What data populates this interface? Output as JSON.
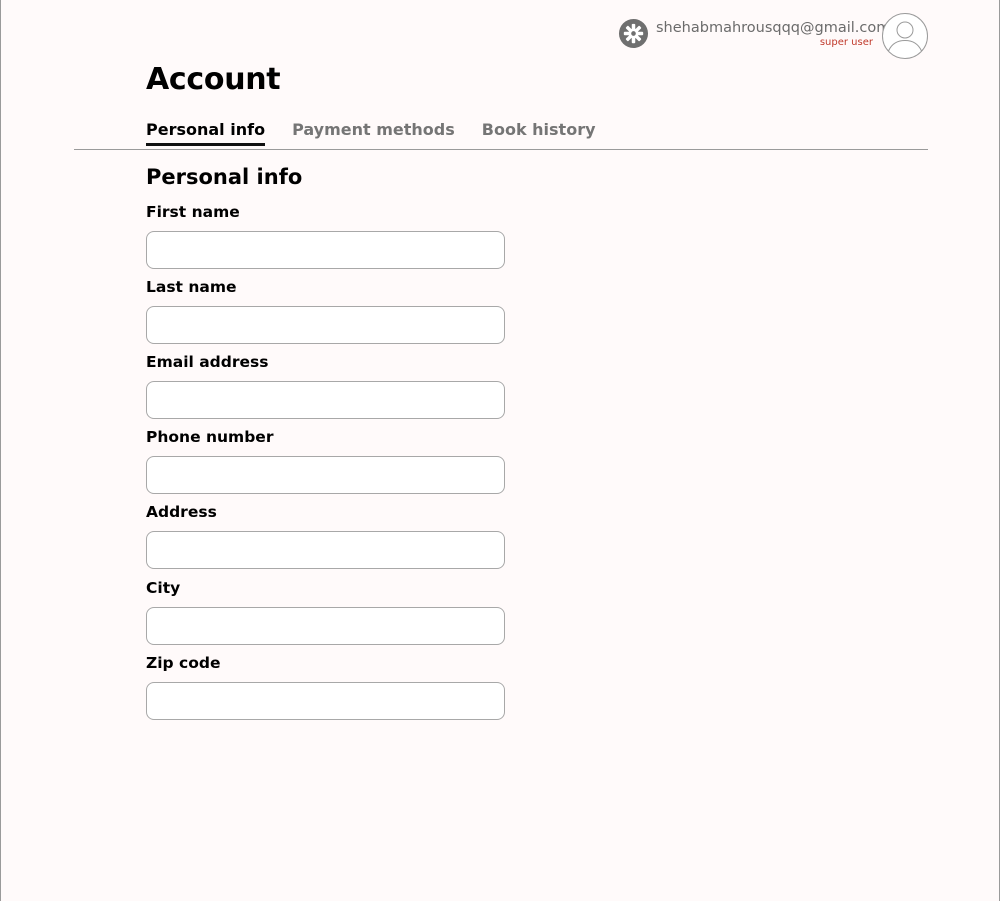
{
  "header": {
    "settings_icon": "gear-icon",
    "user_email": "shehabmahrousqqq@gmail.com",
    "user_role": "super user",
    "avatar_icon": "user-avatar-icon",
    "role_color": "#c0392b"
  },
  "page": {
    "title": "Account"
  },
  "tabs": [
    {
      "label": "Personal info",
      "active": true
    },
    {
      "label": "Payment methods",
      "active": false
    },
    {
      "label": "Book history",
      "active": false
    }
  ],
  "section": {
    "title": "Personal info"
  },
  "form": {
    "first_name": {
      "label": "First name",
      "value": "",
      "placeholder": ""
    },
    "last_name": {
      "label": "Last name",
      "value": "",
      "placeholder": ""
    },
    "email": {
      "label": "Email address",
      "value": "",
      "placeholder": ""
    },
    "phone": {
      "label": "Phone number",
      "value": "",
      "placeholder": ""
    },
    "address": {
      "label": "Address",
      "value": "",
      "placeholder": ""
    },
    "city": {
      "label": "City",
      "value": "",
      "placeholder": ""
    },
    "zip": {
      "label": "Zip code",
      "value": "",
      "placeholder": ""
    }
  }
}
